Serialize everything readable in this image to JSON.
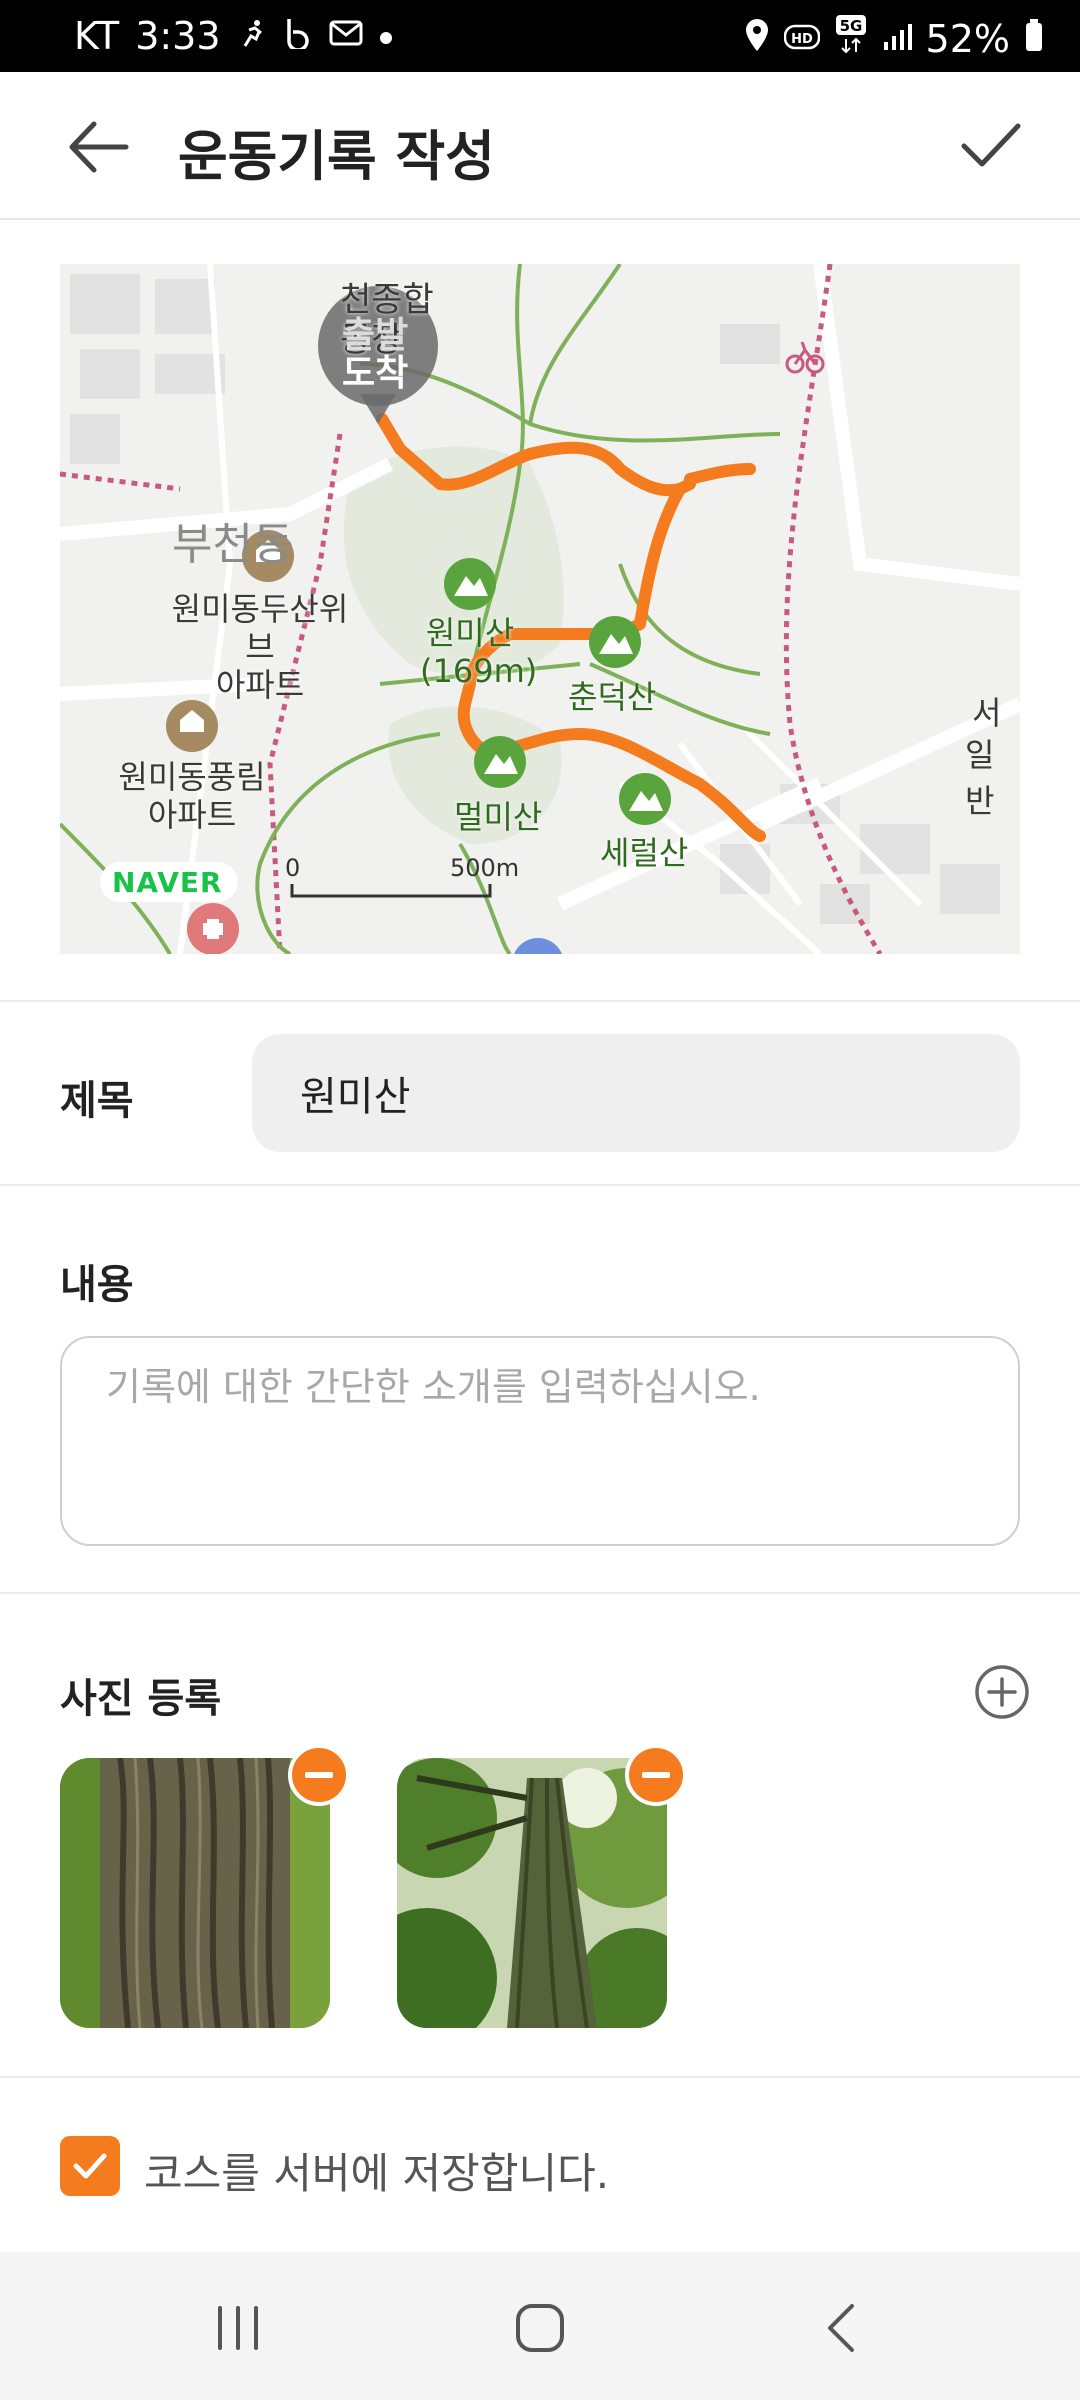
{
  "status": {
    "carrier": "KT",
    "time": "3:33",
    "battery": "52%",
    "icons_left": [
      "run-icon",
      "b-app-icon",
      "mail-icon",
      "dot-icon"
    ],
    "icons_right": [
      "location-icon",
      "hd-icon",
      "5g-icon",
      "signal-icon",
      "battery-icon"
    ]
  },
  "appbar": {
    "title": "운동기록 작성",
    "back_icon": "arrow-left-icon",
    "confirm_icon": "check-icon"
  },
  "map": {
    "labels": {
      "start": "출발",
      "end": "도착",
      "stadium": "천종합\n동장",
      "bucheon": "부천동",
      "apt1_line1": "원미동두산위브",
      "apt1_line2": "아파트",
      "apt2_line1": "원미동풍림",
      "apt2_line2": "아파트",
      "wonmi": "원미산",
      "wonmi_height": "(169m)",
      "chundeok": "춘덕산",
      "meolmi": "멀미산",
      "sereol": "세럴산",
      "ilban": "일반",
      "seo": "서",
      "naver": "NAVER",
      "scale_zero": "0",
      "scale_max": "500m"
    },
    "route_color": "#f47b1e",
    "park_color": "#5aa43d"
  },
  "form": {
    "title_label": "제목",
    "title_value": "원미산",
    "content_label": "내용",
    "content_placeholder": "기록에 대한 간단한 소개를 입력하십시오.",
    "photo_label": "사진 등록",
    "save_course_label": "코스를 서버에 저장합니다.",
    "save_course_checked": true
  },
  "photos": [
    {
      "name": "tree-bark-photo-1"
    },
    {
      "name": "tree-bark-photo-2"
    }
  ],
  "colors": {
    "accent": "#f47b1e",
    "field_bg": "#efefef"
  }
}
